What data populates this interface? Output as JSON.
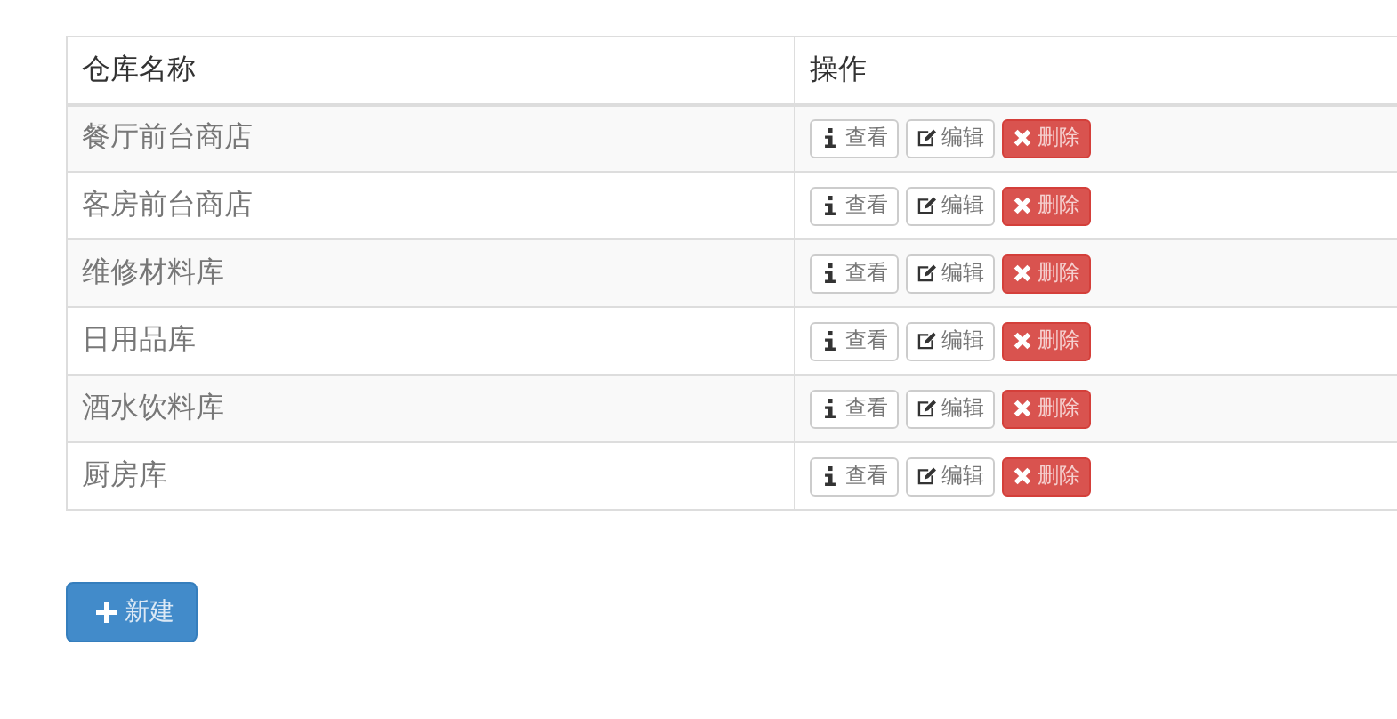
{
  "table": {
    "columns": [
      "仓库名称",
      "操作"
    ],
    "rows": [
      {
        "name": "餐厅前台商店",
        "actions": [
          {
            "kind": "view",
            "label": "查看"
          },
          {
            "kind": "edit",
            "label": "编辑"
          },
          {
            "kind": "delete",
            "label": "删除"
          }
        ]
      },
      {
        "name": "客房前台商店",
        "actions": [
          {
            "kind": "view",
            "label": "查看"
          },
          {
            "kind": "edit",
            "label": "编辑"
          },
          {
            "kind": "delete",
            "label": "删除"
          }
        ]
      },
      {
        "name": "维修材料库",
        "actions": [
          {
            "kind": "view",
            "label": "查看"
          },
          {
            "kind": "edit",
            "label": "编辑"
          },
          {
            "kind": "delete",
            "label": "删除"
          }
        ]
      },
      {
        "name": "日用品库",
        "actions": [
          {
            "kind": "view",
            "label": "查看"
          },
          {
            "kind": "edit",
            "label": "编辑"
          },
          {
            "kind": "delete",
            "label": "删除"
          }
        ]
      },
      {
        "name": "酒水饮料库",
        "actions": [
          {
            "kind": "view",
            "label": "查看"
          },
          {
            "kind": "edit",
            "label": "编辑"
          },
          {
            "kind": "delete",
            "label": "删除"
          }
        ]
      },
      {
        "name": "厨房库",
        "actions": [
          {
            "kind": "view",
            "label": "查看"
          },
          {
            "kind": "edit",
            "label": "编辑"
          },
          {
            "kind": "delete",
            "label": "删除"
          }
        ]
      }
    ]
  },
  "new_button": {
    "label": "新建"
  }
}
